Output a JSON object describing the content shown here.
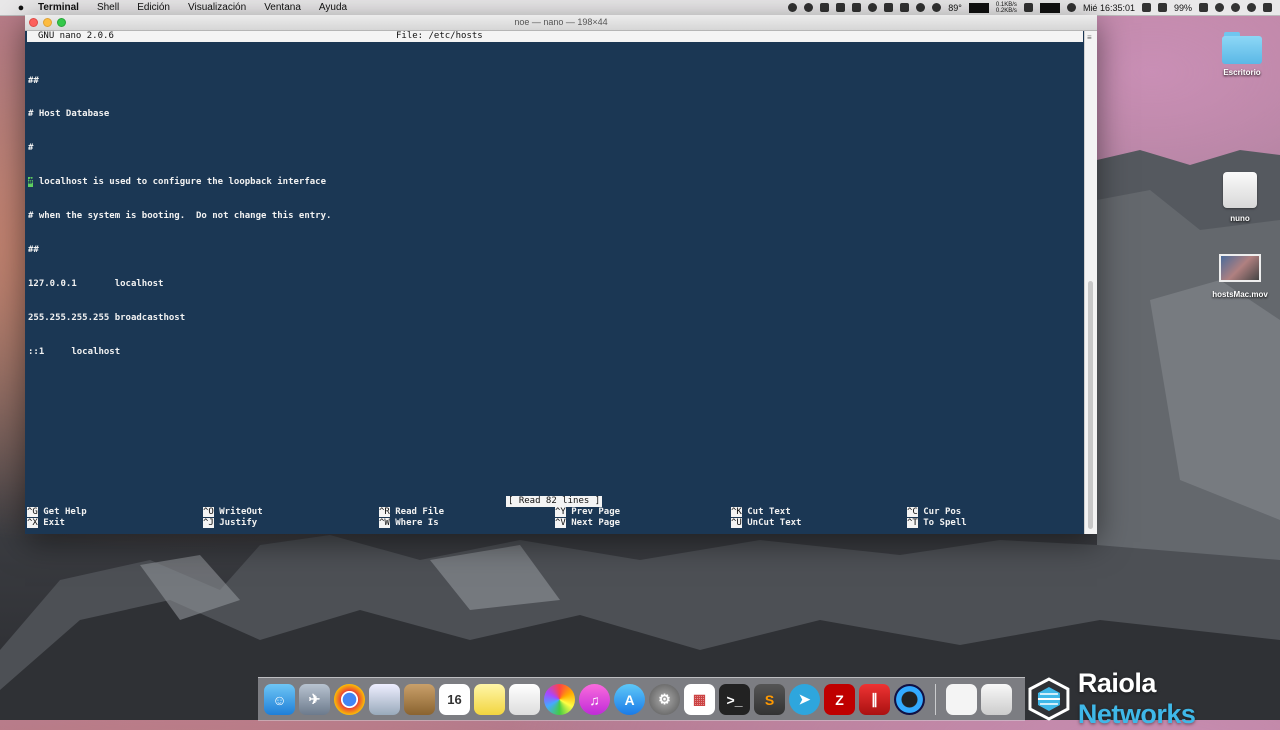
{
  "menubar": {
    "app_name": "Terminal",
    "items": [
      "Shell",
      "Edición",
      "Visualización",
      "Ventana",
      "Ayuda"
    ],
    "status": {
      "temperature": "89°",
      "net_up": "0.1KB/s",
      "net_down": "0.2KB/s",
      "clock": "Mié 16:35:01",
      "battery": "99%"
    }
  },
  "window": {
    "title": "noe — nano — 198×44"
  },
  "nano": {
    "version": "GNU nano 2.0.6",
    "file_label": "File: /etc/hosts",
    "lines": [
      "##",
      "# Host Database",
      "#",
      "# localhost is used to configure the loopback interface",
      "# when the system is booting.  Do not change this entry.",
      "##",
      "127.0.0.1       localhost",
      "255.255.255.255 broadcasthost",
      "::1     localhost"
    ],
    "status_message": "[ Read 82 lines ]",
    "shortcuts": [
      {
        "key": "^G",
        "label": "Get Help"
      },
      {
        "key": "^X",
        "label": "Exit"
      },
      {
        "key": "^O",
        "label": "WriteOut"
      },
      {
        "key": "^J",
        "label": "Justify"
      },
      {
        "key": "^R",
        "label": "Read File"
      },
      {
        "key": "^W",
        "label": "Where Is"
      },
      {
        "key": "^Y",
        "label": "Prev Page"
      },
      {
        "key": "^V",
        "label": "Next Page"
      },
      {
        "key": "^K",
        "label": "Cut Text"
      },
      {
        "key": "^U",
        "label": "UnCut Text"
      },
      {
        "key": "^C",
        "label": "Cur Pos"
      },
      {
        "key": "^T",
        "label": "To Spell"
      }
    ]
  },
  "desktop": {
    "icons": [
      "Escritorio",
      "nuno",
      "hostsMac.mov"
    ]
  },
  "dock": {
    "calendar_day": "16",
    "apps": [
      "finder-icon",
      "launchpad-icon",
      "chrome-icon",
      "preview-icon",
      "contacts-icon",
      "calendar-icon",
      "notes-icon",
      "reminders-icon",
      "photos-icon",
      "itunes-icon",
      "app-store-icon",
      "system-preferences-icon",
      "launchpad-grid-icon",
      "terminal-icon",
      "sublime-text-icon",
      "telegram-icon",
      "filezilla-icon",
      "parallels-icon",
      "quicktime-icon",
      "documents-icon",
      "trash-icon"
    ]
  },
  "watermark": {
    "part1": "Raiola",
    "part2": " Networks"
  },
  "colors": {
    "terminal_bg": "#1b3754",
    "cursor": "#5fcf60"
  }
}
